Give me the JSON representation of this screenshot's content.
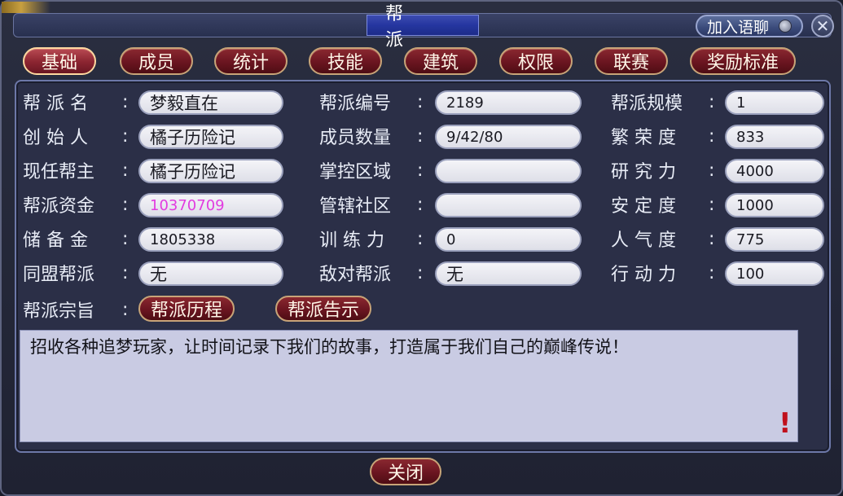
{
  "window": {
    "title": "帮 派",
    "chat_button": "加入语聊",
    "close_icon": "✕",
    "close_button": "关闭"
  },
  "tabs": [
    {
      "label": "基础",
      "active": true
    },
    {
      "label": "成员",
      "active": false
    },
    {
      "label": "统计",
      "active": false
    },
    {
      "label": "技能",
      "active": false
    },
    {
      "label": "建筑",
      "active": false
    },
    {
      "label": "权限",
      "active": false
    },
    {
      "label": "联赛",
      "active": false
    },
    {
      "label": "奖励标准",
      "active": false
    }
  ],
  "info": {
    "col1": [
      {
        "label": "帮 派 名",
        "value": "梦毅直在"
      },
      {
        "label": "创 始 人",
        "value": "橘子历险记"
      },
      {
        "label": "现任帮主",
        "value": "橘子历险记"
      },
      {
        "label": "帮派资金",
        "value": "10370709"
      },
      {
        "label": "储 备 金",
        "value": "1805338"
      },
      {
        "label": "同盟帮派",
        "value": "无"
      }
    ],
    "col2": [
      {
        "label": "帮派编号",
        "value": "2189"
      },
      {
        "label": "成员数量",
        "value": "9/42/80"
      },
      {
        "label": "掌控区域",
        "value": ""
      },
      {
        "label": "管辖社区",
        "value": ""
      },
      {
        "label": "训 练 力",
        "value": "0"
      },
      {
        "label": "敌对帮派",
        "value": "无"
      }
    ],
    "col3": [
      {
        "label": "帮派规模",
        "value": "1"
      },
      {
        "label": "繁 荣 度",
        "value": "833"
      },
      {
        "label": "研 究 力",
        "value": "4000"
      },
      {
        "label": "安 定 度",
        "value": "1000"
      },
      {
        "label": "人 气 度",
        "value": "775"
      },
      {
        "label": "行 动 力",
        "value": "100"
      }
    ]
  },
  "motto": {
    "label": "帮派宗旨",
    "history_button": "帮派历程",
    "notice_button": "帮派告示",
    "text": "招收各种追梦玩家，让时间记录下我们的故事，打造属于我们自己的巅峰传说！",
    "mark": "!"
  },
  "colors": {
    "money": "#e23ce0",
    "tab_red": "#6a1520",
    "panel": "#2b2f47"
  }
}
